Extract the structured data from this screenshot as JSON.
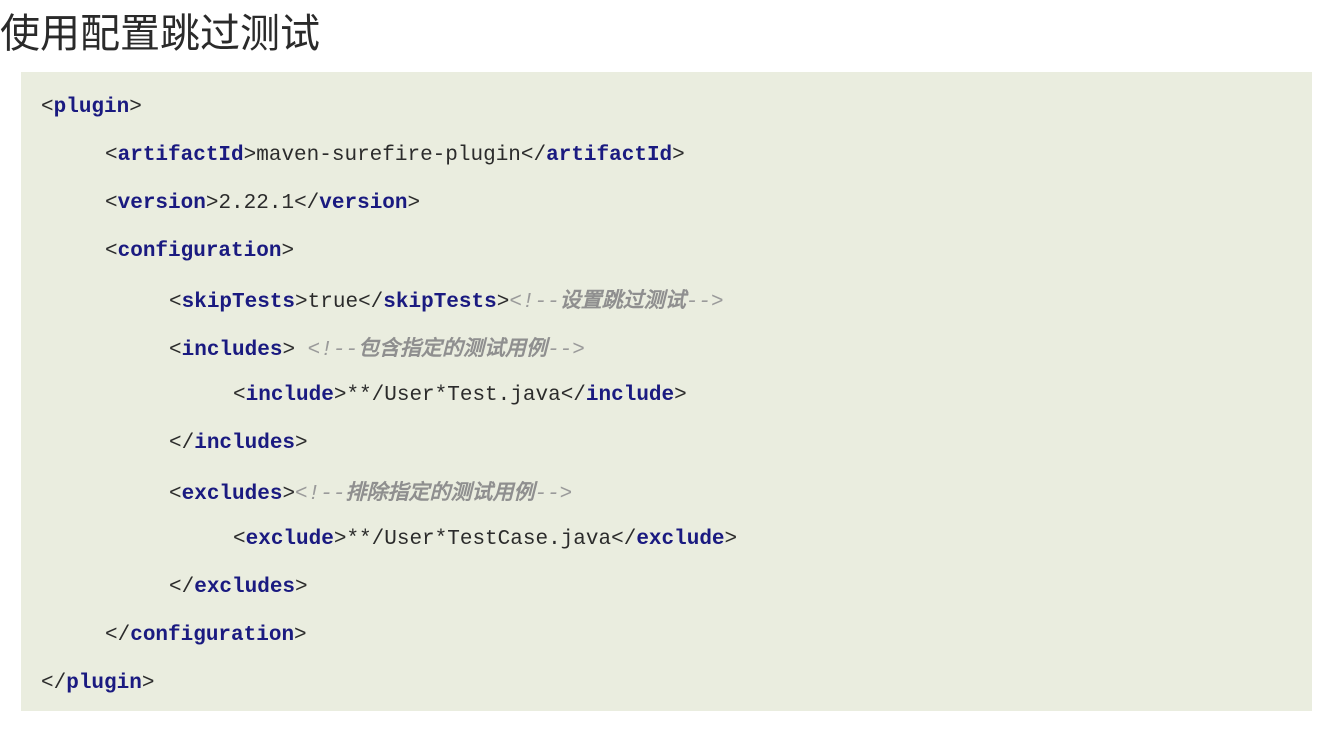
{
  "title": "使用配置跳过测试",
  "code": {
    "lines": [
      {
        "indent": 0,
        "open": "plugin"
      },
      {
        "indent": 1,
        "open": "artifactId",
        "text": "maven-surefire-plugin",
        "close": "artifactId"
      },
      {
        "indent": 1,
        "open": "version",
        "text": "2.22.1",
        "close": "version"
      },
      {
        "indent": 1,
        "open": "configuration"
      },
      {
        "indent": 2,
        "open": "skipTests",
        "text": "true",
        "close": "skipTests",
        "comment_prefix": "<!--",
        "comment_text": "设置跳过测试",
        "comment_suffix": "-->"
      },
      {
        "indent": 2,
        "open": "includes",
        "comment_prefix": " <!--",
        "comment_text": "包含指定的测试用例",
        "comment_suffix": "-->"
      },
      {
        "indent": 3,
        "open": "include",
        "text": "**/User*Test.java",
        "close": "include"
      },
      {
        "indent": 2,
        "close_only": "includes"
      },
      {
        "indent": 2,
        "open": "excludes",
        "comment_prefix": "<!--",
        "comment_text": "排除指定的测试用例",
        "comment_suffix": "-->"
      },
      {
        "indent": 3,
        "open": "exclude",
        "text": "**/User*TestCase.java",
        "close": "exclude"
      },
      {
        "indent": 2,
        "close_only": "excludes"
      },
      {
        "indent": 1,
        "close_only": "configuration"
      },
      {
        "indent": 0,
        "close_only": "plugin"
      }
    ]
  }
}
